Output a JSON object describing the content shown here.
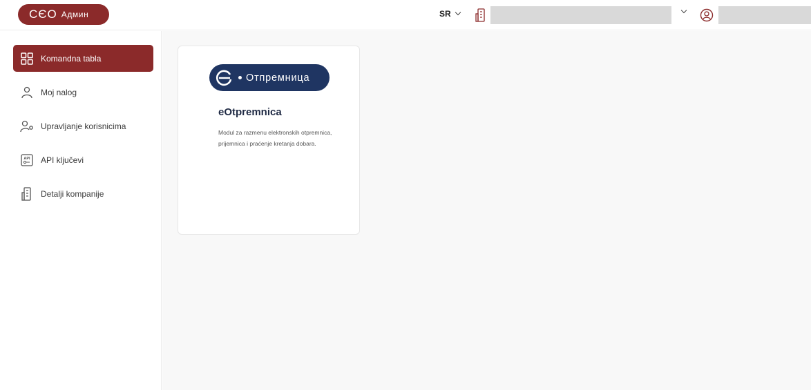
{
  "header": {
    "logo_mark": "CЄO",
    "logo_text": "Админ",
    "language": "SR",
    "company_name": "",
    "user_name": ""
  },
  "sidebar": {
    "items": [
      {
        "label": "Komandna tabla",
        "icon": "dashboard-icon",
        "active": true
      },
      {
        "label": "Moj nalog",
        "icon": "user-icon",
        "active": false
      },
      {
        "label": "Upravljanje korisnicima",
        "icon": "user-settings-icon",
        "active": false
      },
      {
        "label": "API ključevi",
        "icon": "api-key-icon",
        "active": false
      },
      {
        "label": "Detalji kompanije",
        "icon": "building-icon",
        "active": false
      }
    ]
  },
  "main": {
    "cards": [
      {
        "badge_text": "Отпремница",
        "title": "eOtpremnica",
        "description": "Modul za razmenu elektronskih otpremnica, prijemnica i praćenje kretanja dobara."
      }
    ]
  },
  "colors": {
    "brand": "#8b2a2a",
    "badge": "#1f3562",
    "placeholder": "#d9d9d9"
  }
}
